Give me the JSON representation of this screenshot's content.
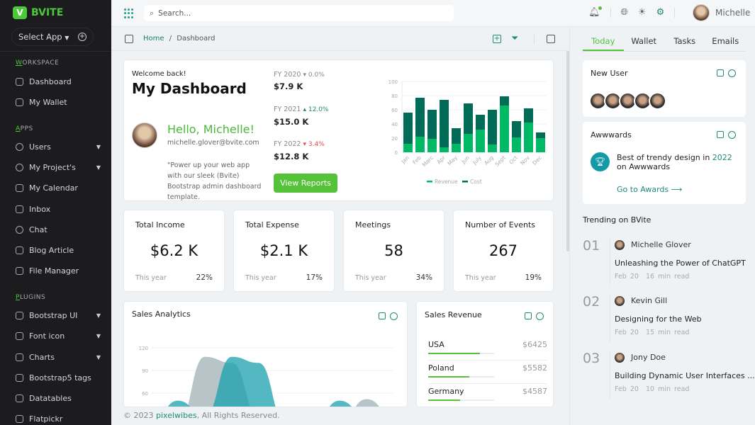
{
  "app": {
    "brand": "BVITE",
    "logo_letter": "V",
    "select_app": "Select App"
  },
  "sidebar": {
    "sections": [
      {
        "label": "WORKSPACE",
        "items": [
          {
            "label": "Dashboard"
          },
          {
            "label": "My Wallet"
          }
        ]
      },
      {
        "label": "APPS",
        "items": [
          {
            "label": "Users",
            "caret": true
          },
          {
            "label": "My Project's",
            "caret": true
          },
          {
            "label": "My Calendar"
          },
          {
            "label": "Inbox"
          },
          {
            "label": "Chat"
          },
          {
            "label": "Blog Article"
          },
          {
            "label": "File Manager"
          }
        ]
      },
      {
        "label": "PLUGINS",
        "items": [
          {
            "label": "Bootstrap UI",
            "caret": true
          },
          {
            "label": "Font icon",
            "caret": true
          },
          {
            "label": "Charts",
            "caret": true
          },
          {
            "label": "Bootstrap5 tags"
          },
          {
            "label": "Datatables"
          },
          {
            "label": "Flatpickr"
          }
        ]
      }
    ]
  },
  "topbar": {
    "search_placeholder": "Search...",
    "user_name": "Michelle"
  },
  "breadcrumb": {
    "home": "Home",
    "sep": "/",
    "current": "Dashboard"
  },
  "welcome": {
    "greeting": "Welcome back!",
    "title": "My Dashboard",
    "hello": "Hello, Michelle!",
    "email": "michelle.glover@bvite.com",
    "quote": "\"Power up your web app with our sleek (Bvite) Bootstrap admin dashboard template.",
    "button": "View Reports",
    "fiscal": [
      {
        "label": "FY 2020",
        "trend": "▾ 0.0%",
        "value": "$7.9 K",
        "color": "#888888"
      },
      {
        "label": "FY 2021",
        "trend": "▴ 12.0%",
        "value": "$15.0 K",
        "color": "#1e8a5a"
      },
      {
        "label": "FY 2022",
        "trend": "▾ 3.4%",
        "value": "$12.8 K",
        "color": "#e04848"
      }
    ]
  },
  "chart_data": [
    {
      "type": "bar",
      "stacked": true,
      "categories": [
        "Jan",
        "Feb",
        "Marc",
        "Apr",
        "May",
        "Jun",
        "July",
        "Aug",
        "Sept",
        "Oct",
        "Nov",
        "Dec"
      ],
      "series": [
        {
          "name": "Revenue",
          "color": "#00b964",
          "values": [
            12,
            22,
            19,
            7,
            12,
            26,
            32,
            11,
            66,
            21,
            42,
            20
          ]
        },
        {
          "name": "Cost",
          "color": "#006b56",
          "values": [
            44,
            55,
            41,
            67,
            22,
            43,
            21,
            49,
            13,
            23,
            20,
            8
          ]
        }
      ],
      "ylim": [
        0,
        100
      ],
      "yticks": [
        "100",
        "80",
        "60",
        "40",
        "20",
        "0"
      ],
      "grid": true,
      "legend": "bottom"
    },
    {
      "type": "area",
      "title": "Sales Analytics",
      "yticks": [
        "120",
        "90",
        "60"
      ],
      "series": [
        {
          "color": "#9fb0b6",
          "values": [
            20,
            20,
            108,
            100,
            30,
            20,
            20,
            20,
            52,
            30
          ]
        },
        {
          "color": "#1aa0ae",
          "values": [
            20,
            50,
            30,
            108,
            100,
            20,
            20,
            50,
            30,
            20
          ]
        }
      ]
    }
  ],
  "stats": [
    {
      "title": "Total Income",
      "value": "$6.2 K",
      "foot": "This year",
      "pct": "22%"
    },
    {
      "title": "Total Expense",
      "value": "$2.1 K",
      "foot": "This year",
      "pct": "17%"
    },
    {
      "title": "Meetings",
      "value": "58",
      "foot": "This year",
      "pct": "34%"
    },
    {
      "title": "Number of Events",
      "value": "267",
      "foot": "This year",
      "pct": "19%"
    }
  ],
  "sales_revenue": {
    "title": "Sales Revenue",
    "rows": [
      {
        "country": "USA",
        "value": "$6425",
        "progress": 78
      },
      {
        "country": "Poland",
        "value": "$5582",
        "progress": 62
      },
      {
        "country": "Germany",
        "value": "$4587",
        "progress": 48
      }
    ]
  },
  "footer": {
    "prefix": "© 2023 ",
    "brand": "pixelwibes",
    "suffix": ", All Rights Reserved."
  },
  "right": {
    "tabs": [
      "Today",
      "Wallet",
      "Tasks",
      "Emails"
    ],
    "new_user_title": "New User",
    "awards": {
      "title": "Awwwards",
      "text_pre": "Best of trendy design in ",
      "year": "2022",
      "text_post": " on Awwwards",
      "link": "Go to Awards ⟶"
    },
    "trending_title": "Trending on BVite",
    "trending": [
      {
        "num": "01",
        "author": "Michelle Glover",
        "title": "Unleashing the Power of ChatGPT",
        "date": "Feb 20",
        "read": "16 min read"
      },
      {
        "num": "02",
        "author": "Kevin Gill",
        "title": "Designing for the Web",
        "date": "Feb 20",
        "read": "15 min read"
      },
      {
        "num": "03",
        "author": "Jony Doe",
        "title": "Building Dynamic User Interfaces ...",
        "date": "Feb 20",
        "read": "10 min read"
      }
    ]
  }
}
